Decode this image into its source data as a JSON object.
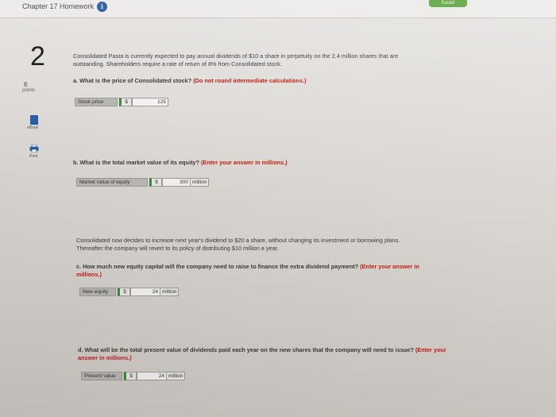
{
  "header": {
    "title": "Chapter 17 Homework",
    "info_icon": "i",
    "saved_label": "Saved"
  },
  "left_panel": {
    "question_number": "2",
    "points_value": "6",
    "points_label": "points",
    "ebook_label": "eBook",
    "print_label": "Print"
  },
  "question": {
    "intro_line1": "Consolidated Pasta is currently expected to pay annual dividends of $10 a share in perpetuity on the 2.4 million shares that are",
    "intro_line2": "outstanding. Shareholders require a rate of return of 8% from Consolidated stock.",
    "part_a": {
      "prompt": "a. What is the price of Consolidated stock?",
      "note": "(Do not round intermediate calculations.)",
      "answer_label": "Stock price",
      "currency": "$",
      "value": "125"
    },
    "part_b": {
      "prompt": "b. What is the total market value of its equity?",
      "note": "(Enter your answer in millions.)",
      "answer_label": "Market value of equity",
      "currency": "$",
      "value": "300",
      "unit": "million"
    },
    "scenario_line1": "Consolidated now decides to increase next year's dividend to $20 a share, without changing its investment or borrowing plans.",
    "scenario_line2": "Thereafter the company will revert to its policy of distributing $10 million a year.",
    "part_c": {
      "prompt_line1": "c. How much new equity capital will the company need to raise to finance the extra dividend payment?",
      "note_line1": "(Enter your answer in",
      "note_line2": "millions.)",
      "answer_label": "New equity",
      "currency": "$",
      "value": "24",
      "unit": "million"
    },
    "part_d": {
      "prompt_line1": "d. What will be the total present value of dividends paid each year on the new shares that the company will need to issue?",
      "note_line1": "(Enter your",
      "note_line2": "answer in millions.)",
      "answer_label": "Present value",
      "currency": "$",
      "value": "24",
      "unit": "million"
    }
  }
}
